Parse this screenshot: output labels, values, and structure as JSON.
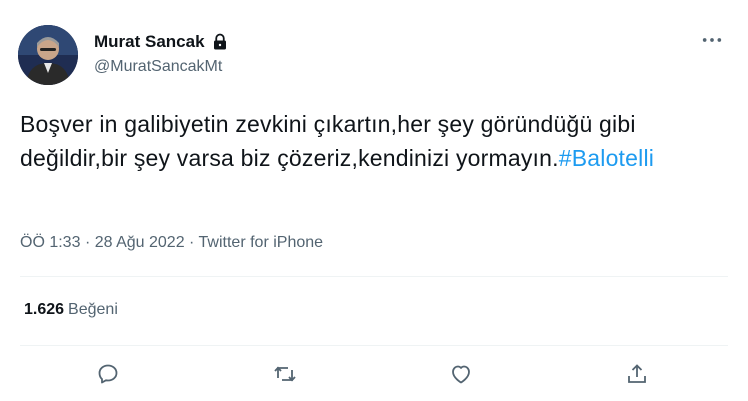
{
  "tweet": {
    "author": {
      "display_name": "Murat Sancak",
      "handle": "@MuratSancakMt",
      "protected_icon": "lock-icon"
    },
    "text_main": "Boşver in galibiyetin zevkini çıkartın,her şey göründüğü gibi değildir,bir şey varsa biz çözeriz,kendinizi yormayın.",
    "hashtag": "#Balotelli",
    "time": "ÖÖ 1:33",
    "separator": "·",
    "date": "28 Ağu 2022",
    "source": "Twitter for iPhone",
    "likes_count": "1.626",
    "likes_label": "Beğeni",
    "colors": {
      "link": "#1d9bf0",
      "secondary_text": "#536471",
      "divider": "#eff3f4"
    },
    "icons": {
      "more": "more-dots-icon",
      "reply": "reply-icon",
      "retweet": "retweet-icon",
      "like": "heart-icon",
      "share": "share-icon"
    }
  }
}
